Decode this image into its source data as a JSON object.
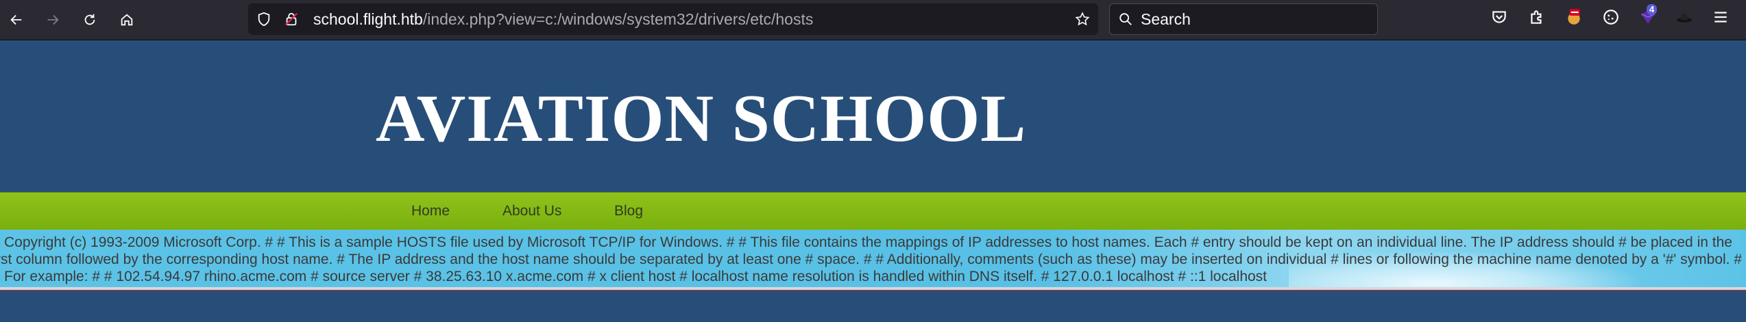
{
  "browser": {
    "url_host": "school.flight.htb",
    "url_path": "/index.php?view=c:/windows/system32/drivers/etc/hosts",
    "search_placeholder": "Search",
    "extension_badge": "4"
  },
  "site": {
    "logo": "AVIATION SCHOOL",
    "nav": [
      {
        "label": "Home"
      },
      {
        "label": "About Us"
      },
      {
        "label": "Blog"
      }
    ]
  },
  "hosts_file": {
    "line1": "Copyright (c) 1993-2009 Microsoft Corp. # # This is a sample HOSTS file used by Microsoft TCP/IP for Windows. # # This file contains the mappings of IP addresses to host names. Each # entry should be kept on an individual line. The IP address should # be placed in the",
    "line2": "rst column followed by the corresponding host name. # The IP address and the host name should be separated by at least one # space. # # Additionally, comments (such as these) may be inserted on individual # lines or following the machine name denoted by a '#' symbol. #",
    "line3": "For example: # # 102.54.94.97 rhino.acme.com # source server # 38.25.63.10 x.acme.com # x client host # localhost name resolution is handled within DNS itself. # 127.0.0.1 localhost # ::1 localhost"
  },
  "colors": {
    "chrome_bg": "#2b2a33",
    "page_header": "#274e79",
    "nav_green": "#86bb14",
    "content_cyan": "#5cc3e7"
  }
}
